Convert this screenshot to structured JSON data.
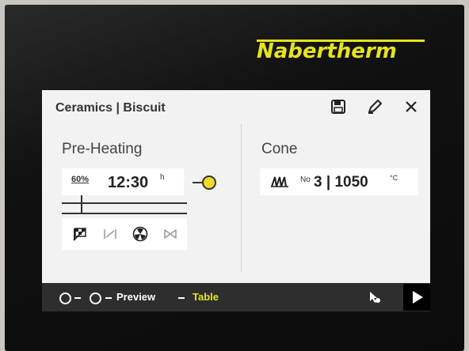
{
  "brand": {
    "logo_text": "Nabertherm",
    "logo_color": "#e6e31e"
  },
  "header": {
    "title": "Ceramics | Biscuit",
    "icons": [
      "save-icon",
      "pencil-icon",
      "close-icon"
    ]
  },
  "left": {
    "label": "Pre-Heating",
    "rate": "60%",
    "time": "12:30",
    "time_unit": "h",
    "status_dot_color": "#f1da2a",
    "controls": [
      "flag-icon",
      "ramp-icon",
      "fan-icon",
      "valve-icon"
    ]
  },
  "right": {
    "label": "Cone",
    "cone_icon": "cone-flame-icon",
    "no_prefix": "No",
    "cone_value": "3 | 1050",
    "cone_unit": "°C"
  },
  "footer": {
    "preview_label": "Preview",
    "table_label": "Table",
    "table_color": "#e6e31e",
    "play_icon": "play-icon",
    "pointer_icon": "pointer-icon"
  }
}
